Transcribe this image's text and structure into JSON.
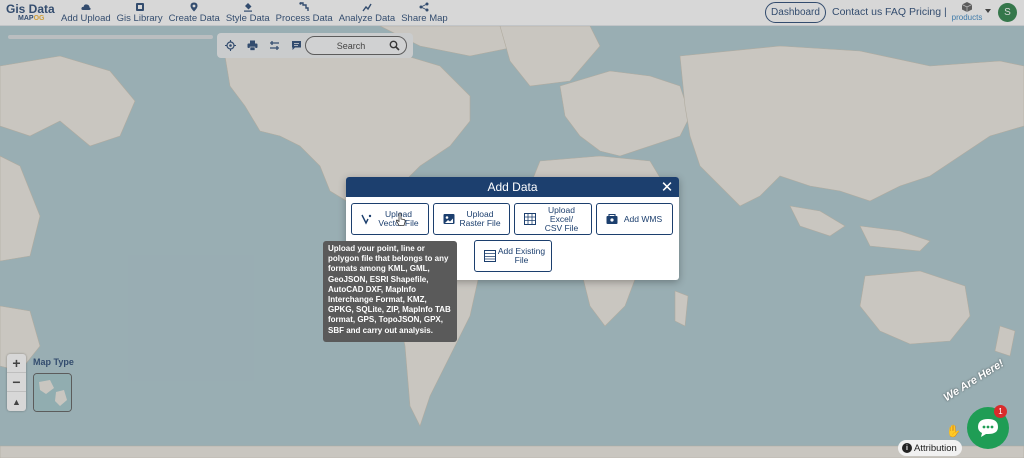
{
  "nav": {
    "logo_top": "Gis Data",
    "logo_bottom_a": "MAP",
    "logo_bottom_b": "OG",
    "items": [
      {
        "label": "Add Upload",
        "icon": "cloud-upload-icon"
      },
      {
        "label": "Gis Library",
        "icon": "library-icon"
      },
      {
        "label": "Create Data",
        "icon": "map-pin-icon"
      },
      {
        "label": "Style Data",
        "icon": "paint-bucket-icon"
      },
      {
        "label": "Process Data",
        "icon": "process-icon"
      },
      {
        "label": "Analyze Data",
        "icon": "analyze-icon"
      },
      {
        "label": "Share Map",
        "icon": "share-icon"
      }
    ],
    "dashboard": "Dashboard",
    "contact": "Contact us",
    "faq": "FAQ",
    "pricing": "Pricing |",
    "products": "products",
    "avatar_letter": "S"
  },
  "toolbar": {
    "search_placeholder": "Search",
    "icons": [
      "locate-icon",
      "print-icon",
      "measure-icon",
      "comment-icon"
    ]
  },
  "map_controls": {
    "zoom_in": "+",
    "zoom_out": "−",
    "north": "▲",
    "map_type_label": "Map Type"
  },
  "modal": {
    "title": "Add Data",
    "close": "✕",
    "options": [
      {
        "label": "Upload\nVector File",
        "icon": "vector-icon"
      },
      {
        "label": "Upload\nRaster File",
        "icon": "raster-icon"
      },
      {
        "label": "Upload Excel/\nCSV File",
        "icon": "spreadsheet-icon"
      },
      {
        "label": "Add WMS",
        "icon": "wms-icon"
      },
      {
        "label": "Add Existing\nFile",
        "icon": "existing-file-icon"
      }
    ]
  },
  "tooltip": "Upload your point, line or polygon file that belongs to any formats among KML, GML, GeoJSON, ESRI Shapefile, AutoCAD DXF, MapInfo Interchange Format, KMZ, GPKG, SQLite, ZIP, MapInfo TAB format, GPS, TopoJSON, GPX, SBF and carry out analysis.",
  "attribution": "Attribution",
  "chat": {
    "banner": "We Are Here!",
    "badge": "1"
  },
  "colors": {
    "brand": "#1c3f6e",
    "ocean": "#a9c6cd",
    "land": "#ece8df",
    "chat": "#1f9d55"
  }
}
